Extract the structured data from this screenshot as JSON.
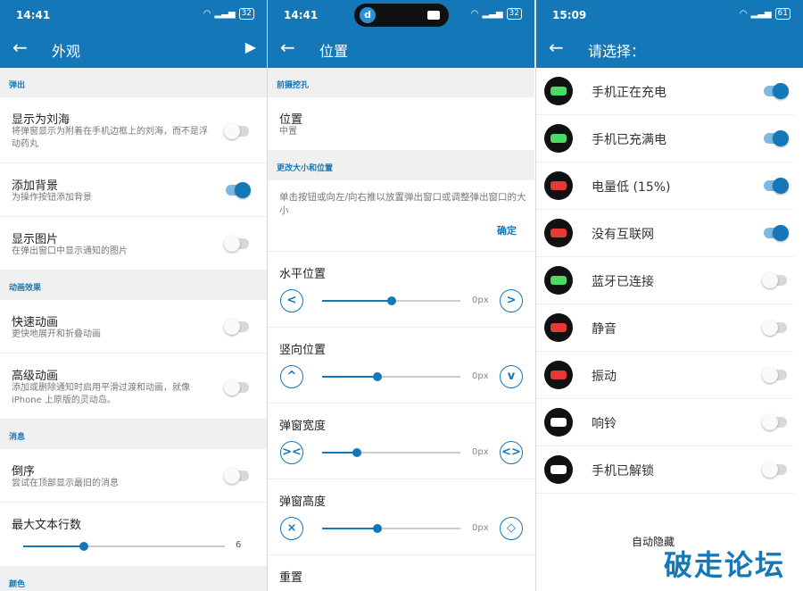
{
  "left": {
    "status_time": "14:41",
    "battery": "32",
    "title": "外观",
    "sections": {
      "popup": "弹出",
      "animation": "动画效果",
      "messages": "消息",
      "color": "颜色"
    },
    "rows": {
      "notch_title": "显示为刘海",
      "notch_sub": "将弹窗显示为附着在手机边框上的刘海，而不是浮动药丸",
      "bg_title": "添加背景",
      "bg_sub": "为操作按钮添加背景",
      "img_title": "显示图片",
      "img_sub": "在弹出窗口中显示通知的图片",
      "fast_title": "快速动画",
      "fast_sub": "更快地展开和折叠动画",
      "adv_title": "高级动画",
      "adv_sub": "添加或删除通知时启用平滑过渡和动画，就像 iPhone 上原版的灵动岛。",
      "rev_title": "倒序",
      "rev_sub": "尝试在顶部显示最旧的消息",
      "maxlines_title": "最大文本行数",
      "maxlines_value": "6"
    },
    "toggles": {
      "notch": false,
      "bg": true,
      "img": false,
      "fast": false,
      "adv": false,
      "rev": false
    },
    "maxlines_fraction": 0.3
  },
  "middle": {
    "status_time": "14:41",
    "battery": "32",
    "title": "位置",
    "sections": {
      "cutout": "前摄挖孔",
      "resize": "更改大小和位置"
    },
    "position_title": "位置",
    "position_value": "中置",
    "hint": "单击按钮或向左/向右推以放置弹出窗口或调整弹出窗口的大小",
    "confirm": "确定",
    "sliders": [
      {
        "title": "水平位置",
        "value": "0px",
        "fraction": 0.5,
        "left_glyph": "<",
        "right_glyph": ">"
      },
      {
        "title": "竖向位置",
        "value": "0px",
        "fraction": 0.4,
        "left_glyph": "^",
        "right_glyph": "v"
      },
      {
        "title": "弹窗宽度",
        "value": "0px",
        "fraction": 0.25,
        "left_glyph": "><",
        "right_glyph": "<>"
      },
      {
        "title": "弹窗高度",
        "value": "0px",
        "fraction": 0.4,
        "left_glyph": "⨯",
        "right_glyph": "◇"
      }
    ],
    "reset": "重置"
  },
  "right": {
    "status_time": "15:09",
    "battery": "61",
    "title": "请选择：",
    "items": [
      {
        "label": "手机正在充电",
        "on": true,
        "icon": "battery-charging-icon",
        "color": "#4cd964"
      },
      {
        "label": "手机已充满电",
        "on": true,
        "icon": "battery-full-icon",
        "color": "#4cd964"
      },
      {
        "label": "电量低 (15%)",
        "on": true,
        "icon": "battery-low-icon",
        "color": "#e53935"
      },
      {
        "label": "没有互联网",
        "on": true,
        "icon": "no-wifi-icon",
        "color": "#e53935"
      },
      {
        "label": "蓝牙已连接",
        "on": false,
        "icon": "bluetooth-icon",
        "color": "#4cd964"
      },
      {
        "label": "静音",
        "on": false,
        "icon": "mute-icon",
        "color": "#e53935"
      },
      {
        "label": "振动",
        "on": false,
        "icon": "vibrate-icon",
        "color": "#e53935"
      },
      {
        "label": "响铃",
        "on": false,
        "icon": "bell-icon",
        "color": "#ffffff"
      },
      {
        "label": "手机已解锁",
        "on": false,
        "icon": "unlock-icon",
        "color": "#ffffff"
      }
    ],
    "auto_hide": "自动隐藏"
  },
  "watermark": "破走论坛",
  "accent": "#1478b8"
}
